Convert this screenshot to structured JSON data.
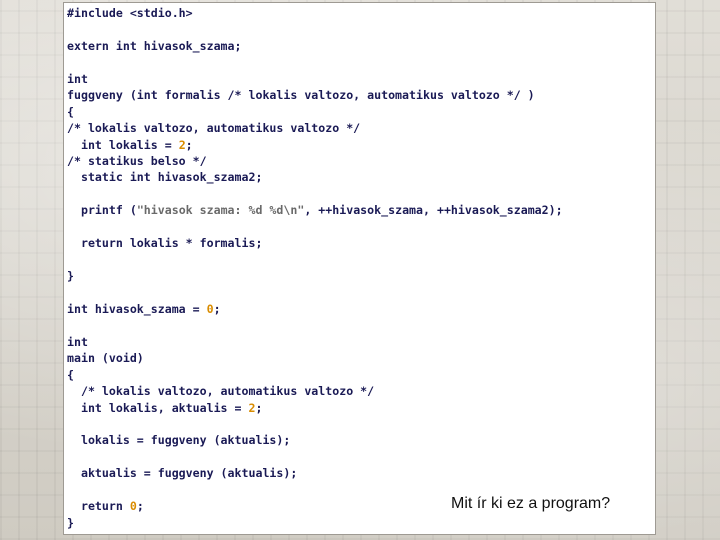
{
  "code_lines": [
    "#include <stdio.h>",
    "",
    "extern int hivasok_szama;",
    "",
    "int",
    "fuggveny (int formalis /* lokalis valtozo, automatikus valtozo */ )",
    "{",
    "/* lokalis valtozo, automatikus valtozo */",
    "  int lokalis = 2;",
    "/* statikus belso */",
    "  static int hivasok_szama2;",
    "",
    "  printf (\"hivasok szama: %d %d\\n\", ++hivasok_szama, ++hivasok_szama2);",
    "",
    "  return lokalis * formalis;",
    "",
    "}",
    "",
    "int hivasok_szama = 0;",
    "",
    "int",
    "main (void)",
    "{",
    "  /* lokalis valtozo, automatikus valtozo */",
    "  int lokalis, aktualis = 2;",
    "",
    "  lokalis = fuggveny (aktualis);",
    "",
    "  aktualis = fuggveny (aktualis);",
    "",
    "  return 0;",
    "}"
  ],
  "caption": "Mit ír ki ez a program?",
  "colors": {
    "code": "#1a1a55",
    "number": "#d98c00",
    "string": "#6a6a6a",
    "background": "#d9d6cf",
    "panel": "#ffffff"
  }
}
